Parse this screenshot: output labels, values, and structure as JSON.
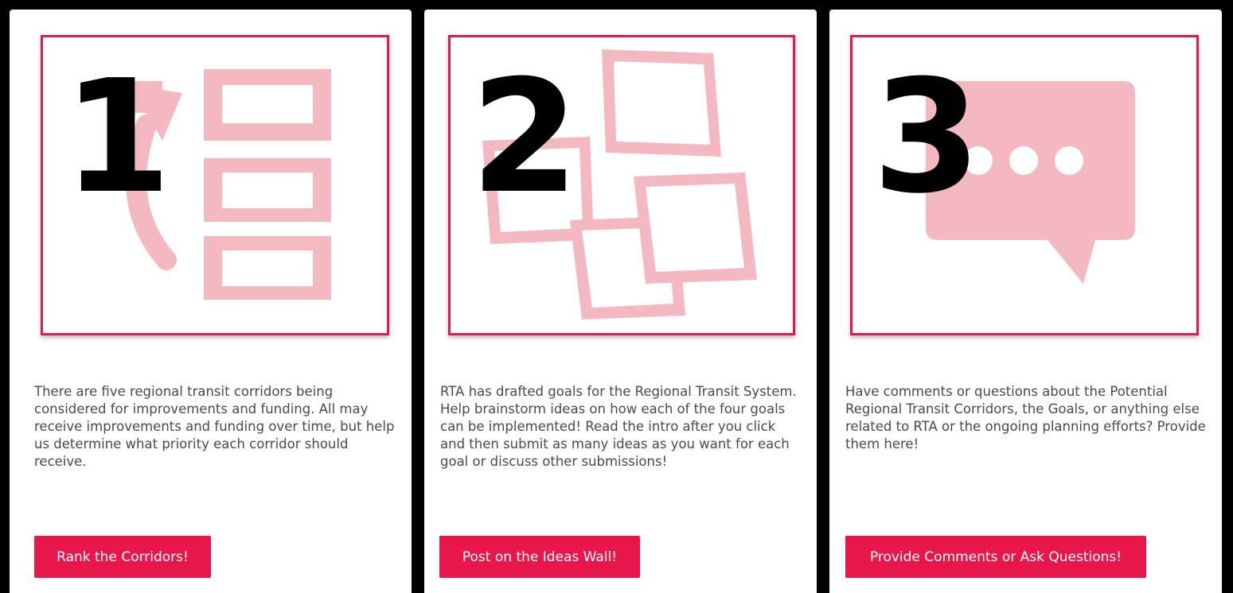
{
  "colors": {
    "accent": "#e8174b",
    "illustration": "#f4b9c0",
    "text": "#4a4a4a",
    "background": "#000000",
    "card": "#ffffff"
  },
  "cards": [
    {
      "number": "1",
      "illustration_icon": "ranked-list-icon",
      "description": "There are five regional transit corridors being considered for improvements and funding.  All may receive improvements and funding over time, but help us determine what priority each corridor should receive.",
      "button_label": "Rank the Corridors!"
    },
    {
      "number": "2",
      "illustration_icon": "sticky-notes-icon",
      "description": "RTA has drafted goals for the Regional Transit System.  Help brainstorm ideas on how each of the four goals can be implemented!  Read the intro after you click and then submit as many ideas as you want for each goal or discuss other submissions!",
      "button_label": "Post on the Ideas Wall!"
    },
    {
      "number": "3",
      "illustration_icon": "speech-bubble-icon",
      "description": "Have comments or questions about the Potential Regional Transit Corridors, the Goals, or anything else related to RTA or the ongoing planning efforts?  Provide them here!",
      "button_label": "Provide Comments or Ask Questions!"
    }
  ]
}
